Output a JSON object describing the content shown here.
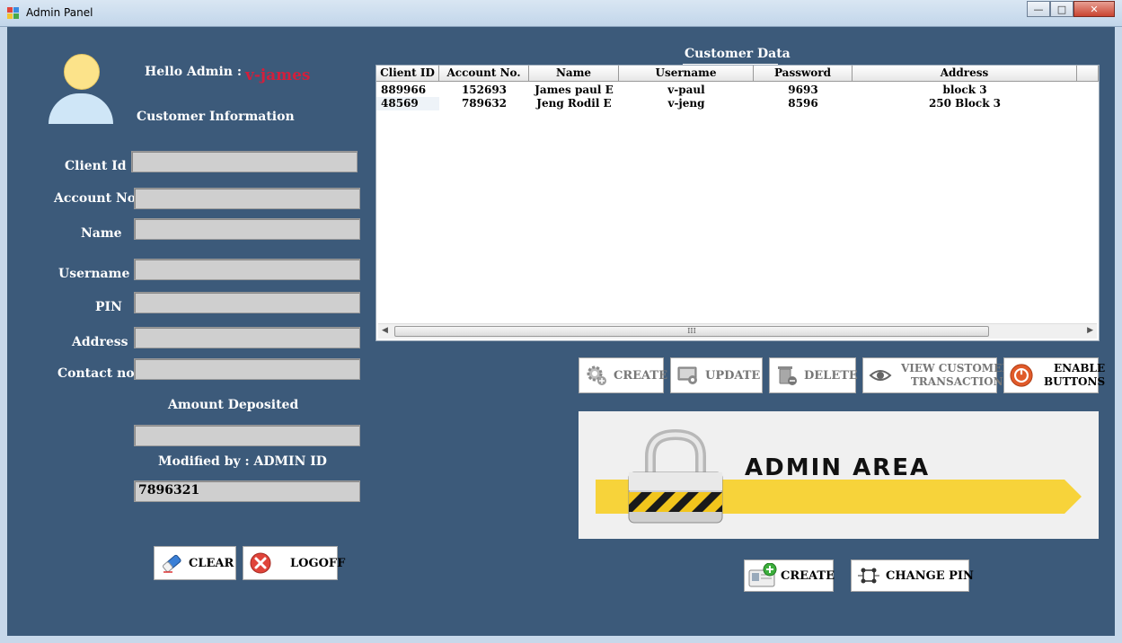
{
  "window": {
    "title": "Admin Panel",
    "minimize": "—",
    "maximize": "□",
    "close": "✕"
  },
  "header": {
    "greeting": "Hello Admin :",
    "username": "v-james",
    "section_title": "Customer Information"
  },
  "form": {
    "client_id_label": "Client Id",
    "account_no_label": "Account No.",
    "name_label": "Name",
    "username_label": "Username",
    "pin_label": "PIN",
    "address_label": "Address",
    "contact_label": "Contact no.",
    "amount_label": "Amount Deposited",
    "modified_label": "Modified by : ADMIN ID",
    "client_id": "",
    "account_no": "",
    "name": "",
    "username": "",
    "pin": "",
    "address": "",
    "contact": "",
    "amount": "",
    "modified_by": "7896321"
  },
  "left_buttons": {
    "clear": "CLEAR",
    "logoff": "LOGOFF"
  },
  "grid": {
    "title": "Customer Data",
    "columns": [
      "Client ID",
      "Account No.",
      "Name",
      "Username",
      "Password",
      "Address"
    ],
    "rows": [
      [
        "889966",
        "152693",
        "James paul E",
        "v-paul",
        "9693",
        "block 3"
      ],
      [
        "48569",
        "789632",
        "Jeng Rodil E",
        "v-jeng",
        "8596",
        "250 Block 3"
      ]
    ],
    "scroll_grip": "III"
  },
  "actions": {
    "create": "CREATE",
    "update": "UPDATE",
    "delete": "DELETE",
    "view_line1": "VIEW CUSTOMER",
    "view_line2": "TRANSACTIONS",
    "enable_line1": "ENABLE",
    "enable_line2": "BUTTONS"
  },
  "banner": {
    "text": "ADMIN AREA"
  },
  "bottom_buttons": {
    "create": "CREATE",
    "change_pin": "CHANGE PIN"
  },
  "colors": {
    "background": "#3c5a7a",
    "username": "#d21f3c",
    "banner_stripe": "#f7d33a"
  }
}
